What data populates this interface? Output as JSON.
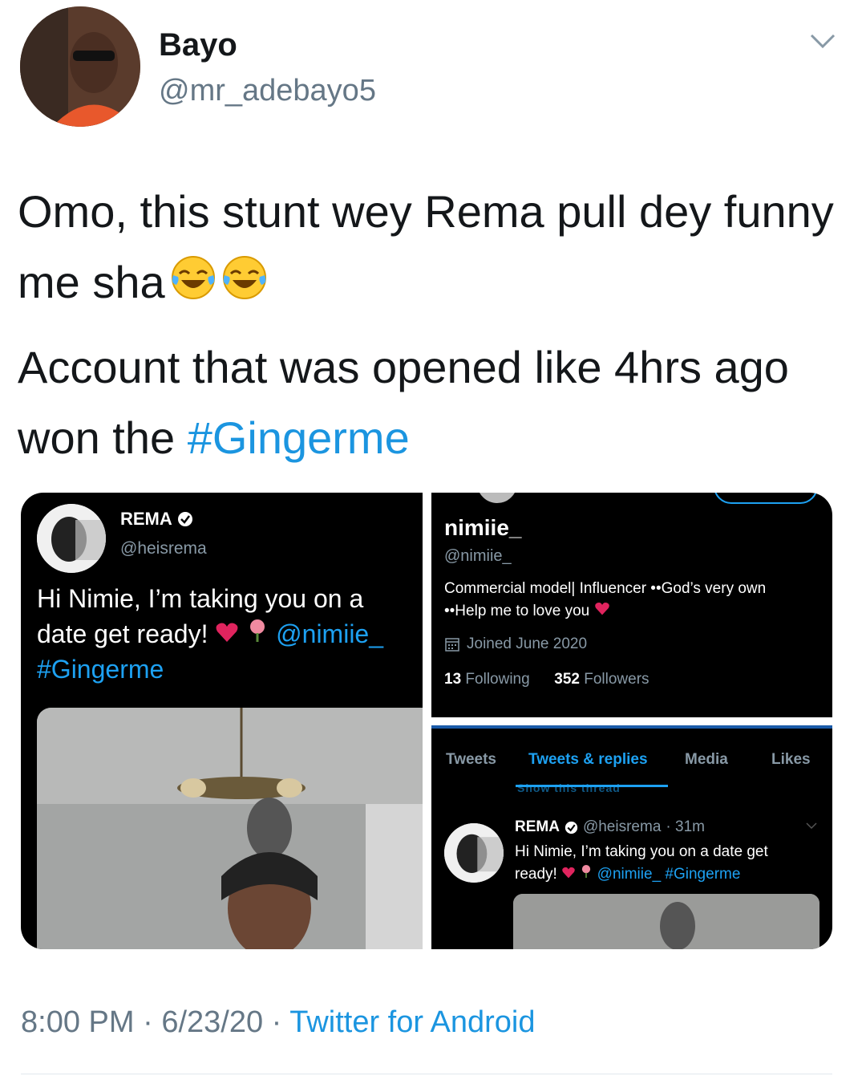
{
  "author": {
    "display_name": "Bayo",
    "handle": "@mr_adebayo5"
  },
  "tweet": {
    "line1": "Omo, this stunt wey Rema pull dey funny me sha",
    "line2_prefix": "Account that was opened like 4hrs ago won the",
    "hashtag": "#Gingerme",
    "emojis": [
      "face-with-tears-of-joy",
      "face-with-tears-of-joy"
    ]
  },
  "media": {
    "rema_tweet": {
      "name": "REMA",
      "handle": "@heisrema",
      "text_main": "Hi Nimie, I’m taking you on a date get ready!",
      "mention": "@nimiie_",
      "hashtag": "#Gingerme"
    },
    "profile": {
      "name": "nimiie_",
      "handle": "@nimiie_",
      "bio_line1": "Commercial model| Influencer ••God’s very own",
      "bio_line2": "••Help me to love you",
      "joined": "Joined June 2020",
      "following_count": "13",
      "following_label": "Following",
      "followers_count": "352",
      "followers_label": "Followers"
    },
    "tabs": {
      "items": [
        "Tweets",
        "Tweets & replies",
        "Media",
        "Likes"
      ],
      "active": "Tweets & replies",
      "ghost_text": "Show this thread"
    },
    "mini_tweet": {
      "name": "REMA",
      "handle": "@heisrema",
      "time": "· 31m",
      "text_line1": "Hi Nimie, I’m taking you on a date get",
      "text_line2_prefix": "ready!",
      "mention": "@nimiie_",
      "hashtag": "#Gingerme"
    }
  },
  "footer": {
    "time": "8:00 PM",
    "sep1": "·",
    "date": "6/23/20",
    "sep2": "·",
    "source": "Twitter for Android"
  },
  "colors": {
    "link": "#1b95e0",
    "text": "#14171a",
    "muted": "#657786",
    "dark_bg": "#000000"
  }
}
